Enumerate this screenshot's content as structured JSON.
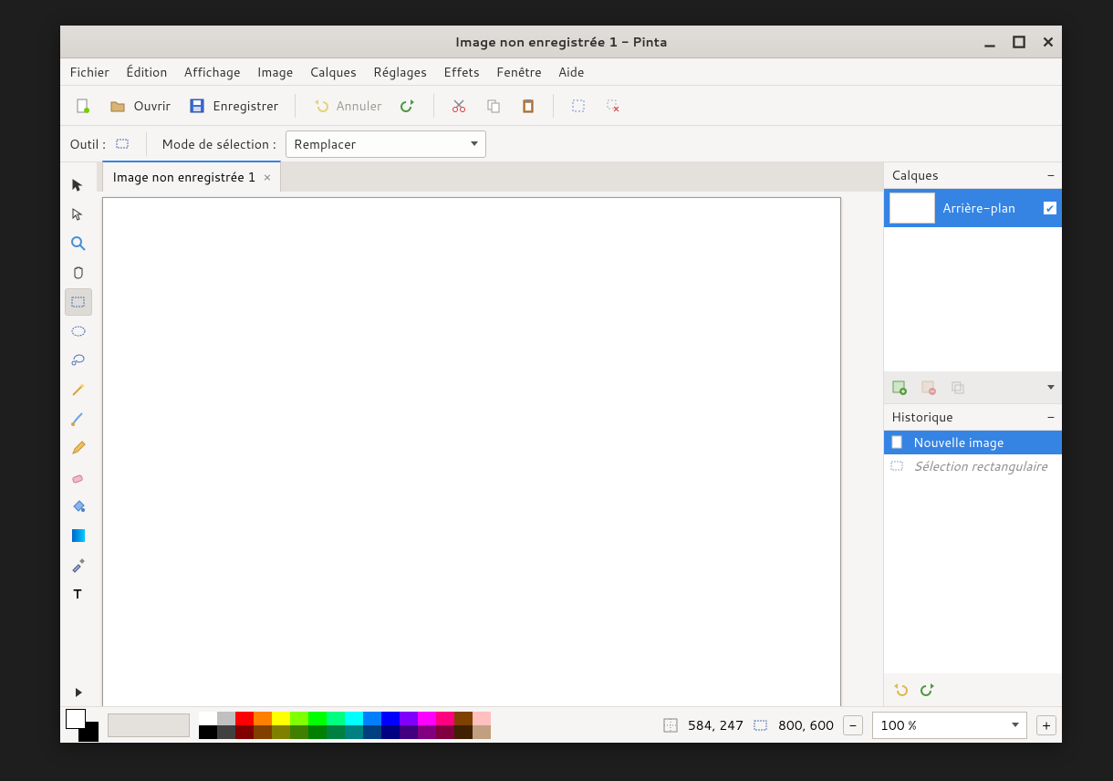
{
  "window": {
    "title": "Image non enregistrée 1 - Pinta"
  },
  "menu": {
    "file": "Fichier",
    "edit": "Édition",
    "view": "Affichage",
    "image": "Image",
    "layers": "Calques",
    "adjust": "Réglages",
    "effects": "Effets",
    "window": "Fenêtre",
    "help": "Aide"
  },
  "toolbar": {
    "open": "Ouvrir",
    "save": "Enregistrer",
    "undo": "Annuler"
  },
  "tooloptions": {
    "tool_label": "Outil :",
    "selmode_label": "Mode de sélection :",
    "selmode_value": "Remplacer"
  },
  "tabs": {
    "tab1": "Image non enregistrée 1"
  },
  "panels": {
    "layers_title": "Calques",
    "layer1_name": "Arrière-plan",
    "history_title": "Historique",
    "hist1": "Nouvelle image",
    "hist2": "Sélection rectangulaire"
  },
  "status": {
    "cursor": "584, 247",
    "size": "800, 600",
    "zoom": "100 %"
  },
  "palette_row1": [
    "#ffffff",
    "#c0c0c0",
    "#ff0000",
    "#ff8000",
    "#ffff00",
    "#80ff00",
    "#00ff00",
    "#00ff80",
    "#00ffff",
    "#0080ff",
    "#0000ff",
    "#8000ff",
    "#ff00ff",
    "#ff0080",
    "#804000",
    "#ffc0c0"
  ],
  "palette_row2": [
    "#000000",
    "#404040",
    "#800000",
    "#804000",
    "#808000",
    "#408000",
    "#008000",
    "#008040",
    "#008080",
    "#004080",
    "#000080",
    "#400080",
    "#800080",
    "#800040",
    "#402000",
    "#c0a080"
  ]
}
